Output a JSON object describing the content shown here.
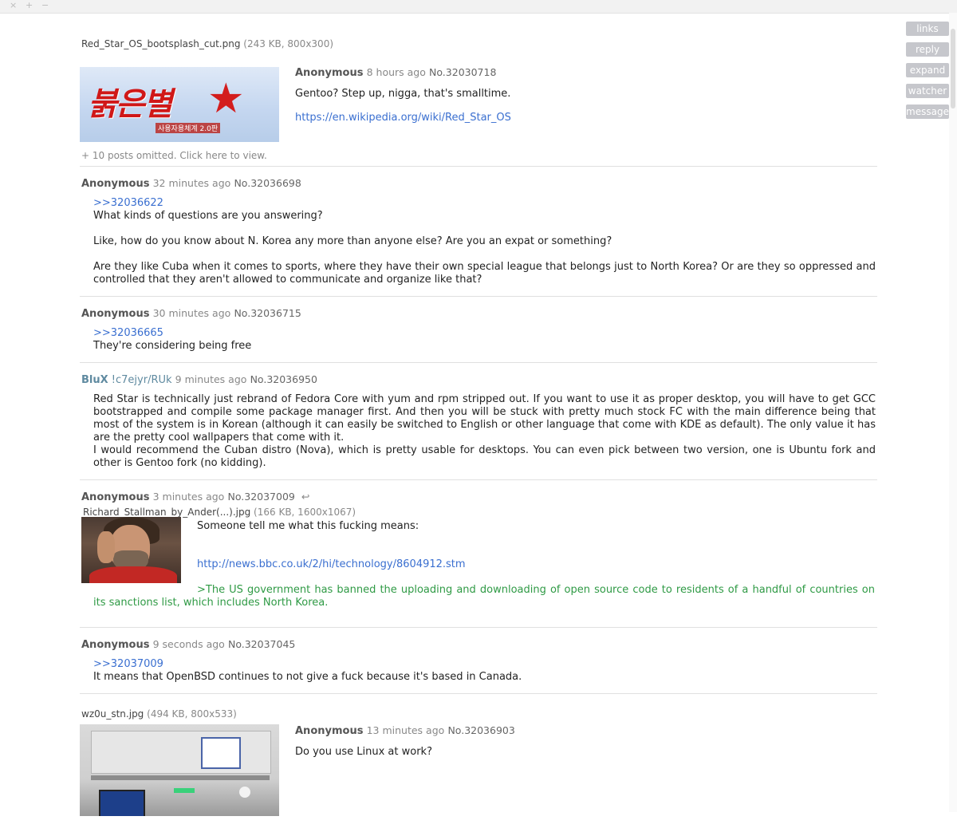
{
  "window": {
    "controls": [
      "×",
      "+",
      "−"
    ]
  },
  "side_buttons": [
    "links",
    "reply",
    "expand",
    "watcher",
    "message"
  ],
  "op": {
    "file_name": "Red_Star_OS_bootsplash_cut.png",
    "file_info": "(243 KB, 800x300)",
    "image_text": "붉은별",
    "image_subtext": "사용자용체계 2.0판",
    "name": "Anonymous",
    "time": "8 hours ago",
    "post_no": "No.32030718",
    "body": "Gentoo? Step up, nigga, that's smalltime.",
    "link": "https://en.wikipedia.org/wiki/Red_Star_OS"
  },
  "omitted": "+  10 posts omitted. Click here to view.",
  "replies": [
    {
      "name": "Anonymous",
      "time": "32 minutes ago",
      "post_no": "No.32036698",
      "quote": ">>32036622",
      "lines": [
        "What kinds of questions are you answering?",
        "Like, how do you know about N. Korea any more than anyone else? Are you an expat or something?",
        "Are they like Cuba when it comes to sports, where they have their own special league that belongs just to North Korea? Or are they so oppressed and controlled that they aren't allowed to communicate and organize like that?"
      ]
    },
    {
      "name": "Anonymous",
      "time": "30 minutes ago",
      "post_no": "No.32036715",
      "quote": ">>32036665",
      "lines": [
        "They're considering being free"
      ]
    },
    {
      "name": "BluX",
      "trip": "!c7ejyr/RUk",
      "time": "9 minutes ago",
      "post_no": "No.32036950",
      "lines": [
        "Red Star is technically just rebrand of Fedora Core with yum and rpm stripped out. If you want to use it as proper desktop, you will have to get GCC bootstrapped and compile some package manager first. And then you will be stuck with pretty much stock FC with the main difference being that most of the system is in Korean (although it can easily be switched to English or other language that come with KDE as default). The only value it has are the pretty cool wallpapers that come with it.",
        "I would recommend the Cuban distro (Nova), which is pretty usable for desktops. You can even pick between two version, one is Ubuntu fork and other is Gentoo fork (no kidding)."
      ]
    },
    {
      "name": "Anonymous",
      "time": "3 minutes ago",
      "post_no": "No.32037009",
      "reply_icon": "↩",
      "file_name": "Richard_Stallman_by_Ander(...).jpg",
      "file_info": "(166 KB, 1600x1067)",
      "body": "Someone tell me what this fucking means:",
      "link": "http://news.bbc.co.uk/2/hi/technology/8604912.stm",
      "greentext": ">The US government has banned the uploading and downloading of open source code to residents of a handful of countries on its sanctions list, which includes North Korea."
    },
    {
      "name": "Anonymous",
      "time": "9 seconds ago",
      "post_no": "No.32037045",
      "quote": ">>32037009",
      "lines": [
        "It means that OpenBSD continues to not give a fuck because it's based in Canada."
      ]
    }
  ],
  "thread2": {
    "file_name": "wz0u_stn.jpg",
    "file_info": "(494 KB, 800x533)",
    "name": "Anonymous",
    "time": "13 minutes ago",
    "post_no": "No.32036903",
    "body": "Do you use Linux at work?"
  }
}
